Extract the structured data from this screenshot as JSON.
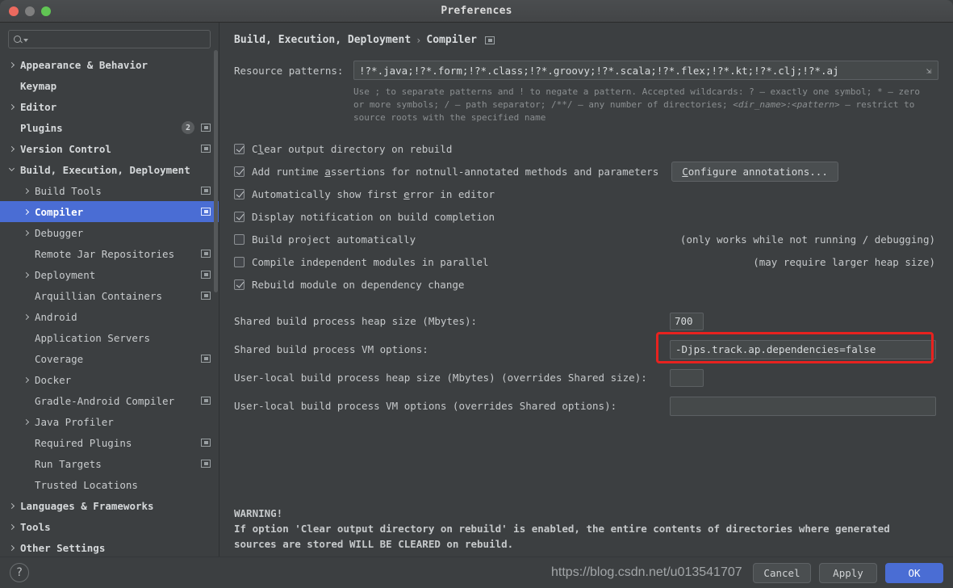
{
  "window": {
    "title": "Preferences"
  },
  "search": {
    "placeholder": "",
    "value": ""
  },
  "sidebar": {
    "items": [
      {
        "label": "Appearance & Behavior",
        "level": 0,
        "chevron": "right",
        "bold": true,
        "mod": false,
        "badge": null,
        "selected": false
      },
      {
        "label": "Keymap",
        "level": 0,
        "chevron": "none",
        "bold": true,
        "mod": false,
        "badge": null,
        "selected": false
      },
      {
        "label": "Editor",
        "level": 0,
        "chevron": "right",
        "bold": true,
        "mod": false,
        "badge": null,
        "selected": false
      },
      {
        "label": "Plugins",
        "level": 0,
        "chevron": "none",
        "bold": true,
        "mod": true,
        "badge": "2",
        "selected": false
      },
      {
        "label": "Version Control",
        "level": 0,
        "chevron": "right",
        "bold": true,
        "mod": true,
        "badge": null,
        "selected": false
      },
      {
        "label": "Build, Execution, Deployment",
        "level": 0,
        "chevron": "down",
        "bold": true,
        "mod": false,
        "badge": null,
        "selected": false
      },
      {
        "label": "Build Tools",
        "level": 1,
        "chevron": "right",
        "bold": false,
        "mod": true,
        "badge": null,
        "selected": false
      },
      {
        "label": "Compiler",
        "level": 1,
        "chevron": "right",
        "bold": true,
        "mod": true,
        "badge": null,
        "selected": true
      },
      {
        "label": "Debugger",
        "level": 1,
        "chevron": "right",
        "bold": false,
        "mod": false,
        "badge": null,
        "selected": false
      },
      {
        "label": "Remote Jar Repositories",
        "level": 1,
        "chevron": "none",
        "bold": false,
        "mod": true,
        "badge": null,
        "selected": false
      },
      {
        "label": "Deployment",
        "level": 1,
        "chevron": "right",
        "bold": false,
        "mod": true,
        "badge": null,
        "selected": false
      },
      {
        "label": "Arquillian Containers",
        "level": 1,
        "chevron": "none",
        "bold": false,
        "mod": true,
        "badge": null,
        "selected": false
      },
      {
        "label": "Android",
        "level": 1,
        "chevron": "right",
        "bold": false,
        "mod": false,
        "badge": null,
        "selected": false
      },
      {
        "label": "Application Servers",
        "level": 1,
        "chevron": "none",
        "bold": false,
        "mod": false,
        "badge": null,
        "selected": false
      },
      {
        "label": "Coverage",
        "level": 1,
        "chevron": "none",
        "bold": false,
        "mod": true,
        "badge": null,
        "selected": false
      },
      {
        "label": "Docker",
        "level": 1,
        "chevron": "right",
        "bold": false,
        "mod": false,
        "badge": null,
        "selected": false
      },
      {
        "label": "Gradle-Android Compiler",
        "level": 1,
        "chevron": "none",
        "bold": false,
        "mod": true,
        "badge": null,
        "selected": false
      },
      {
        "label": "Java Profiler",
        "level": 1,
        "chevron": "right",
        "bold": false,
        "mod": false,
        "badge": null,
        "selected": false
      },
      {
        "label": "Required Plugins",
        "level": 1,
        "chevron": "none",
        "bold": false,
        "mod": true,
        "badge": null,
        "selected": false
      },
      {
        "label": "Run Targets",
        "level": 1,
        "chevron": "none",
        "bold": false,
        "mod": true,
        "badge": null,
        "selected": false
      },
      {
        "label": "Trusted Locations",
        "level": 1,
        "chevron": "none",
        "bold": false,
        "mod": false,
        "badge": null,
        "selected": false
      },
      {
        "label": "Languages & Frameworks",
        "level": 0,
        "chevron": "right",
        "bold": true,
        "mod": false,
        "badge": null,
        "selected": false
      },
      {
        "label": "Tools",
        "level": 0,
        "chevron": "right",
        "bold": true,
        "mod": false,
        "badge": null,
        "selected": false
      },
      {
        "label": "Other Settings",
        "level": 0,
        "chevron": "right",
        "bold": true,
        "mod": false,
        "badge": null,
        "selected": false
      }
    ]
  },
  "breadcrumb": {
    "parent": "Build, Execution, Deployment",
    "separator": "›",
    "current": "Compiler"
  },
  "resource": {
    "label": "Resource patterns:",
    "value": "!?*.java;!?*.form;!?*.class;!?*.groovy;!?*.scala;!?*.flex;!?*.kt;!?*.clj;!?*.aj",
    "hint_line1": "Use ; to separate patterns and ! to negate a pattern. Accepted wildcards: ? — exactly one symbol; * — zero",
    "hint_line2_a": "or more symbols; / — path separator; /**/ — any number of directories; ",
    "hint_line2_i": "<dir_name>:<pattern>",
    "hint_line2_b": " — restrict to",
    "hint_line3": "source roots with the specified name"
  },
  "checkboxes": [
    {
      "label_pre": "C",
      "label_u": "l",
      "label_post": "ear output directory on rebuild",
      "checked": true,
      "note": "",
      "button": null
    },
    {
      "label_pre": "Add runtime ",
      "label_u": "a",
      "label_post": "ssertions for notnull-annotated methods and parameters",
      "checked": true,
      "note": "",
      "button": "Configure annotations..."
    },
    {
      "label_pre": "Automatically show first ",
      "label_u": "e",
      "label_post": "rror in editor",
      "checked": true,
      "note": "",
      "button": null
    },
    {
      "label_pre": "Display notification on build completion",
      "label_u": "",
      "label_post": "",
      "checked": true,
      "note": "",
      "button": null
    },
    {
      "label_pre": "Build project automatically",
      "label_u": "",
      "label_post": "",
      "checked": false,
      "note": "(only works while not running / debugging)",
      "button": null
    },
    {
      "label_pre": "Compile independent modules in parallel",
      "label_u": "",
      "label_post": "",
      "checked": false,
      "note": "(may require larger heap size)",
      "button": null
    },
    {
      "label_pre": "Rebuild module on dependency change",
      "label_u": "",
      "label_post": "",
      "checked": true,
      "note": "",
      "button": null
    }
  ],
  "button_labels": {
    "configure_annotations_u": "C",
    "configure_annotations_rest": "onfigure annotations..."
  },
  "fields": [
    {
      "label": "Shared build process heap size (Mbytes):",
      "value": "700",
      "kind": "small",
      "highlighted": false
    },
    {
      "label": "Shared build process VM options:",
      "value": "-Djps.track.ap.dependencies=false",
      "kind": "wide",
      "highlighted": true
    },
    {
      "label": "User-local build process heap size (Mbytes) (overrides Shared size):",
      "value": "",
      "kind": "small",
      "highlighted": false
    },
    {
      "label": "User-local build process VM options (overrides Shared options):",
      "value": "",
      "kind": "wide",
      "highlighted": false
    }
  ],
  "warning": {
    "title": "WARNING!",
    "line1": "If option 'Clear output directory on rebuild' is enabled, the entire contents of directories where generated",
    "line2": "sources are stored WILL BE CLEARED on rebuild."
  },
  "footer": {
    "help": "?",
    "cancel": "Cancel",
    "apply": "Apply",
    "ok": "OK"
  },
  "watermark": {
    "text": "https://blog.csdn.net/u013541707"
  },
  "colors": {
    "accent": "#4a6dd4",
    "highlight_red": "#e8221f",
    "window_bg": "#3c3f41",
    "text": "#c6c9cb"
  }
}
